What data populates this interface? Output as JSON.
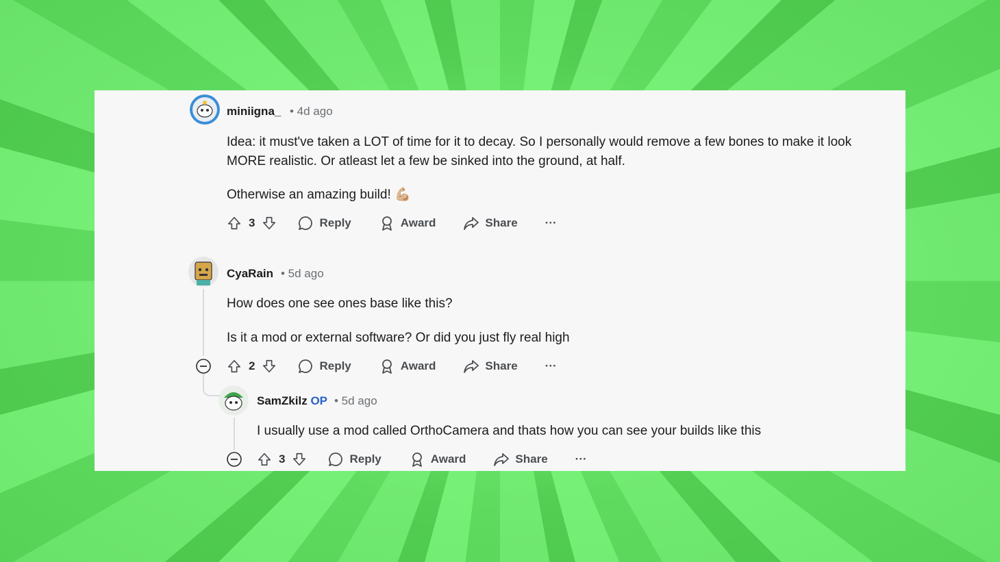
{
  "comments": [
    {
      "username": "miniigna_",
      "time": "• 4d ago",
      "paragraphs": [
        "Idea: it must've taken a LOT of time for it to decay. So I personally would remove a few bones to make it look MORE realistic. Or atleast let a few be sinked into the ground, at half.",
        "Otherwise an amazing build! 💪🏼"
      ],
      "score": "3"
    },
    {
      "username": "CyaRain",
      "time": "• 5d ago",
      "paragraphs": [
        "How does one see ones base like this?",
        "Is it a mod or external software? Or did you just fly real high"
      ],
      "score": "2"
    },
    {
      "username": "SamZkilz",
      "op_badge": "OP",
      "time": "• 5d ago",
      "paragraphs": [
        "I usually use a mod called OrthoCamera and thats how you can see your builds like this"
      ],
      "score": "3"
    }
  ],
  "actions": {
    "reply": "Reply",
    "award": "Award",
    "share": "Share",
    "more": "···"
  },
  "colors": {
    "background": "#6fe86f",
    "panel": "#f7f7f8",
    "op": "#2a62c9"
  }
}
